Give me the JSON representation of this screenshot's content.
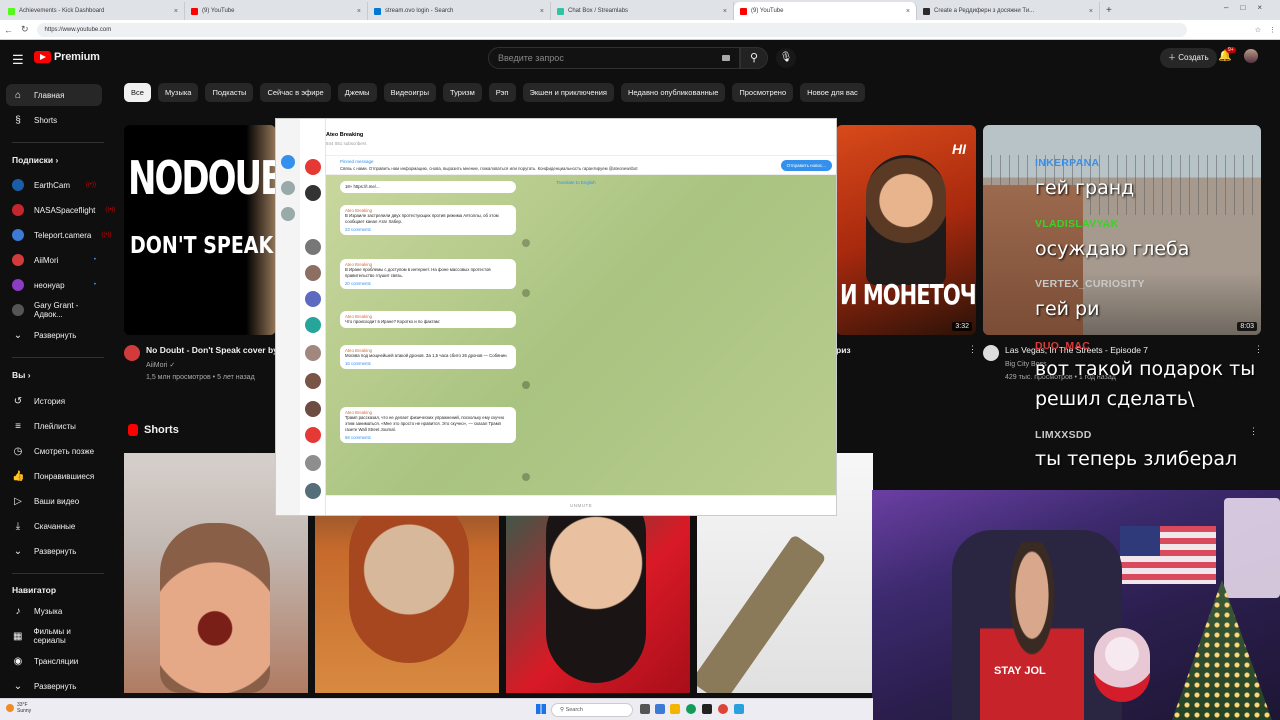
{
  "browser": {
    "tabs": [
      {
        "title": "Achievements - Kick Dashboard",
        "color": "#53fc18"
      },
      {
        "title": "(9) YouTube",
        "color": "#ff0000"
      },
      {
        "title": "stream.ovo login - Search",
        "color": "#0078d4"
      },
      {
        "title": "Chat Box / Streamlabs",
        "color": "#31c3a2"
      },
      {
        "title": "(9) YouTube",
        "color": "#ff0000"
      },
      {
        "title": "Create a Реддиферн з досяжни Ти...",
        "color": "#2b2b2b"
      }
    ],
    "new_tab": "+",
    "url": "https://www.youtube.com"
  },
  "header": {
    "logo_text": "Premium",
    "search_placeholder": "Введите запрос",
    "create_label": "Создать",
    "bell_count": "9+"
  },
  "sidebar": {
    "main": [
      {
        "label": "Главная",
        "icon": "home-icon",
        "selected": true
      },
      {
        "label": "Shorts",
        "icon": "shorts-icon"
      }
    ],
    "subs_heading": "Подписки",
    "subs": [
      {
        "label": "EarthCam",
        "color": "#1c5da8",
        "live": true
      },
      {
        "label": "NASASpaceflight",
        "color": "#c4262e",
        "live": true
      },
      {
        "label": "Teleport.camera",
        "color": "#3c7ad6",
        "live": true
      },
      {
        "label": "AiiMori",
        "color": "#d23b3b",
        "dot": true
      },
      {
        "label": "неонуар",
        "color": "#8b3cc4",
        "dot": true
      },
      {
        "label": "Gary Grant - Адвок...",
        "color": "#555555"
      }
    ],
    "subs_expand": "Развернуть",
    "you_heading": "Вы",
    "you": [
      {
        "label": "История",
        "icon": "history-icon"
      },
      {
        "label": "Плейлисты",
        "icon": "playlists-icon"
      },
      {
        "label": "Смотреть позже",
        "icon": "watch-later-icon"
      },
      {
        "label": "Понравившиеся",
        "icon": "like-icon"
      },
      {
        "label": "Ваши видео",
        "icon": "your-videos-icon"
      },
      {
        "label": "Скачанные",
        "icon": "download-icon"
      },
      {
        "label": "Развернуть",
        "icon": "chevron-down-icon"
      }
    ],
    "nav_heading": "Навигатор",
    "nav": [
      {
        "label": "Музыка",
        "icon": "music-icon"
      },
      {
        "label": "Фильмы и сериалы",
        "icon": "movies-icon"
      },
      {
        "label": "Трансляции",
        "icon": "live-icon"
      },
      {
        "label": "Развернуть",
        "icon": "chevron-down-icon"
      }
    ]
  },
  "chips": [
    "Все",
    "Музыка",
    "Подкасты",
    "Сейчас в эфире",
    "Джемы",
    "Видеоигры",
    "Туризм",
    "Рэп",
    "Экшен и приключения",
    "Недавно опубликованные",
    "Просмотрено",
    "Новое для вас"
  ],
  "videos": [
    {
      "thumb_big": "NODOUBT",
      "thumb_small": "DON'T SPEAK",
      "title": "No Doubt - Don't Speak cover by Ai Mori",
      "channel": "AiiMori",
      "meta": "1,5 млн просмотров • 5 лет назад"
    },
    {
      "thumb_badge": "HI",
      "thumb_text": "И МОНЕТОЧКИ",
      "duration": "3:32",
      "title_tail": "риз"
    },
    {
      "title": "Las Vegas, In The Streets - Episode 7",
      "channel": "Big City Boss",
      "meta": "429 тыс. просмотров • 1 год назад",
      "duration": "8:03"
    }
  ],
  "shorts_heading": "Shorts",
  "telegram": {
    "channel": "Ateo Breaking",
    "subscribers": "844 081 subscribers",
    "pinned_label": "Pinned message",
    "pinned_text": "Связь с нами. Отправить нам информацию, снова, выразить мнение, пожаловаться или поругать. Конфиденциальность гарантируем @ateonewsbot",
    "pinned_button": "Отправить новос...",
    "translate": "Translate to English",
    "messages": [
      {
        "name": "Ateo Breaking",
        "text": "18+ https://t.me/...",
        "meta": ""
      },
      {
        "name": "Ateo Breaking",
        "text": "В Израиле застрелили двух протестующих против режима Аятоллы, об этом сообщает канал Атаг Хабер.",
        "meta": "23 comments"
      },
      {
        "name": "Ateo Breaking",
        "text": "В Иране проблемы с доступом в интернет. На фоне массовых протестов правительство глушит связь.",
        "meta": "20 comments"
      },
      {
        "name": "Ateo Breaking",
        "text": "Что происходит в Иране? Коротко и по фактам:",
        "meta": ""
      },
      {
        "name": "Ateo Breaking",
        "text": "Москва под мощнейшей атакой дронов. За 1,5 часа сбито 26 дронов — Собянин.",
        "meta": "16 comments"
      },
      {
        "name": "Ateo Breaking",
        "text": "Трамп рассказал, что не делает физических упражнений, поскольку ему скучно этим заниматься. «Мне это просто не нравится. Это скучно», — сказал Трамп газете Wall Street Journal.",
        "meta": "68 comments"
      }
    ],
    "input_label": "UNMUTE"
  },
  "chat": [
    {
      "user": "INKERPANA",
      "color": "#3a8ee6",
      "msg": "гей гранд"
    },
    {
      "user": "VLADISLAVYAK",
      "color": "#3bd12a",
      "msg": "осуждаю глеба"
    },
    {
      "user": "VERTEX_CURIOSITY",
      "color": "#c9c9c9",
      "msg": "гей ри"
    },
    {
      "user": "DUO_MAC",
      "color": "#d93a3a",
      "msg": "вот такой подарок ты"
    },
    {
      "user": "",
      "color": "#ffffff",
      "msg": "решил сделать\\"
    },
    {
      "user": "LIMXXSDD",
      "color": "#c9c9c9",
      "msg": "ты теперь злиберал"
    }
  ],
  "webcam": {
    "shirt_text": "STAY JOL"
  },
  "taskbar": {
    "temp": "33°F",
    "weather": "Sunny",
    "search": "Search"
  }
}
